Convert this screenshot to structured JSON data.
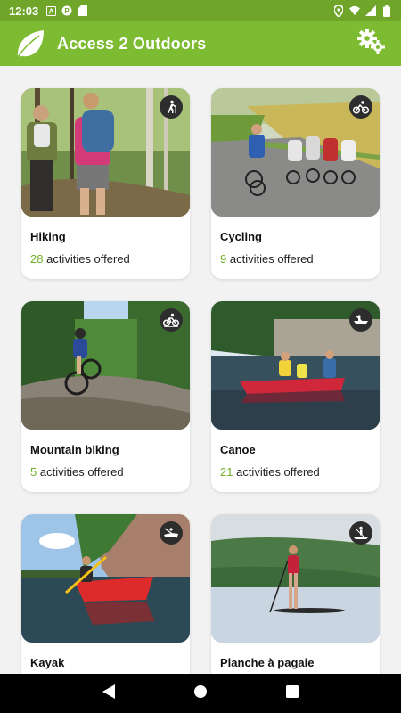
{
  "status_bar": {
    "time": "12:03",
    "left_icons": [
      "a-icon",
      "p-icon",
      "sd-card-icon"
    ],
    "right_icons": [
      "location-icon",
      "wifi-icon",
      "signal-icon",
      "battery-icon"
    ]
  },
  "app_bar": {
    "title": "Access 2 Outdoors",
    "accent_color": "#7cbb32"
  },
  "activities": [
    {
      "name": "Hiking",
      "count": "28",
      "suffix": "activities offered",
      "icon": "hiking-icon"
    },
    {
      "name": "Cycling",
      "count": "9",
      "suffix": "activities offered",
      "icon": "cycling-icon"
    },
    {
      "name": "Mountain biking",
      "count": "5",
      "suffix": "activities offered",
      "icon": "mountain-biking-icon"
    },
    {
      "name": "Canoe",
      "count": "21",
      "suffix": "activities offered",
      "icon": "canoe-icon"
    },
    {
      "name": "Kayak",
      "count": "",
      "suffix": "",
      "icon": "kayak-icon"
    },
    {
      "name": "Planche à pagaie",
      "count": "",
      "suffix": "",
      "icon": "paddleboard-icon"
    }
  ],
  "nav": {
    "buttons": [
      "back-icon",
      "home-icon",
      "recents-icon"
    ]
  }
}
